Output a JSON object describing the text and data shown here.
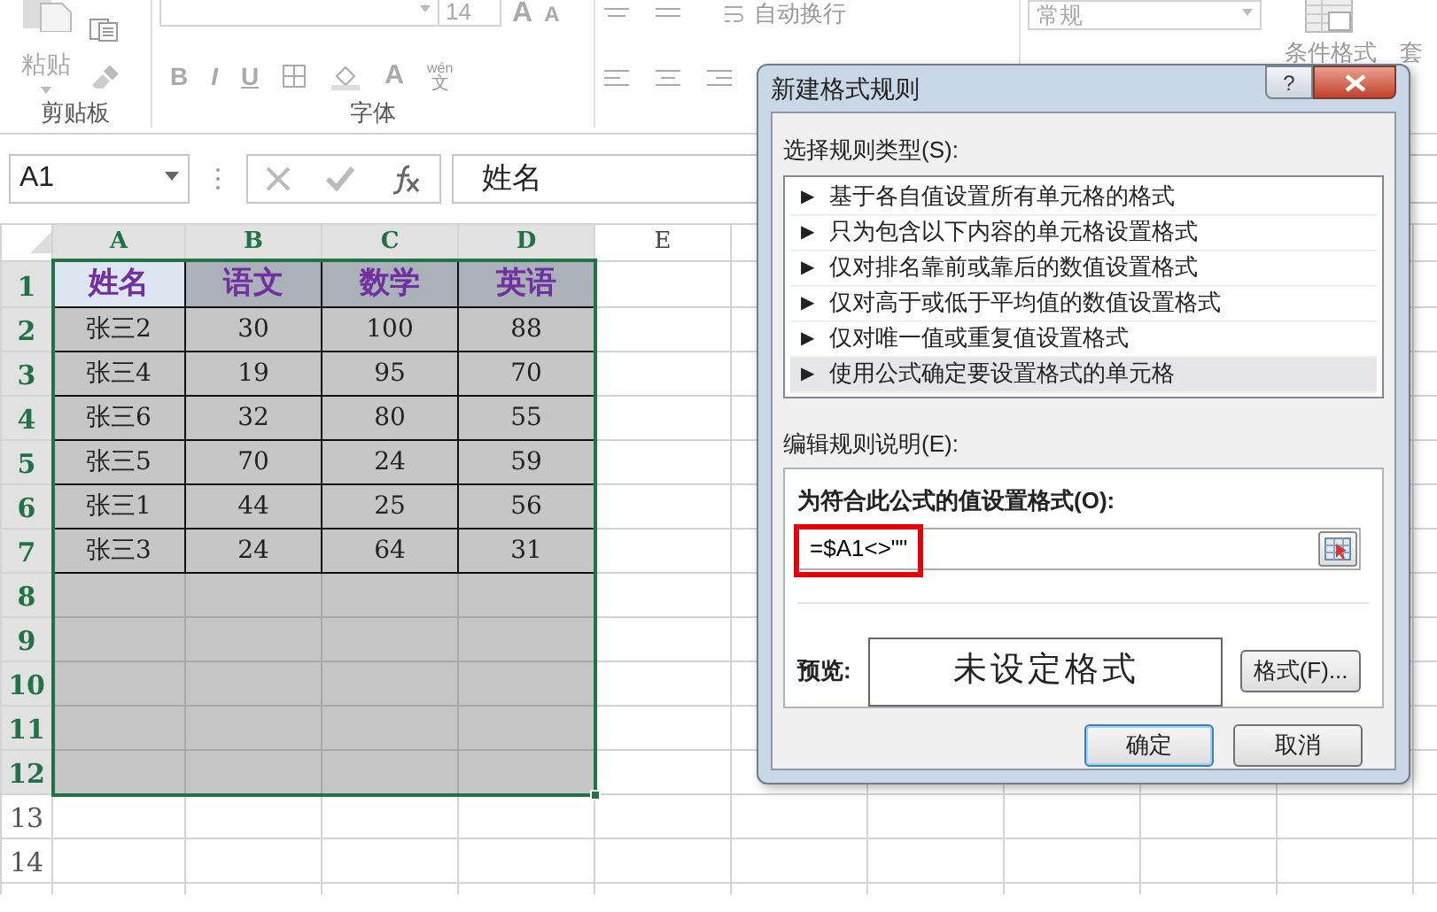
{
  "ribbon": {
    "clipboard": {
      "paste": "粘贴",
      "group_label": "剪贴板"
    },
    "font": {
      "size": "14",
      "grow": "A",
      "shrink": "A",
      "bold": "B",
      "italic": "I",
      "underline": "U",
      "font_color": "A",
      "phonetic_top": "wén",
      "phonetic_bottom": "文",
      "group_label": "字体"
    },
    "alignment": {
      "wrap_text": "自动换行"
    },
    "number": {
      "format": "常规"
    },
    "styles": {
      "conditional": "条件格式",
      "table_style": "套"
    }
  },
  "formula_bar": {
    "name_box": "A1",
    "formula": "姓名"
  },
  "sheet": {
    "columns": [
      {
        "label": "A",
        "selected": true
      },
      {
        "label": "B",
        "selected": true
      },
      {
        "label": "C",
        "selected": true
      },
      {
        "label": "D",
        "selected": true
      },
      {
        "label": "E",
        "selected": false
      }
    ],
    "rows": [
      {
        "number": "1",
        "selected": true,
        "cells": [
          "姓名",
          "语文",
          "数学",
          "英语"
        ]
      },
      {
        "number": "2",
        "selected": true,
        "cells": [
          "张三2",
          "30",
          "100",
          "88"
        ]
      },
      {
        "number": "3",
        "selected": true,
        "cells": [
          "张三4",
          "19",
          "95",
          "70"
        ]
      },
      {
        "number": "4",
        "selected": true,
        "cells": [
          "张三6",
          "32",
          "80",
          "55"
        ]
      },
      {
        "number": "5",
        "selected": true,
        "cells": [
          "张三5",
          "70",
          "24",
          "59"
        ]
      },
      {
        "number": "6",
        "selected": true,
        "cells": [
          "张三1",
          "44",
          "25",
          "56"
        ]
      },
      {
        "number": "7",
        "selected": true,
        "cells": [
          "张三3",
          "24",
          "64",
          "31"
        ]
      },
      {
        "number": "8",
        "selected": true,
        "cells": []
      },
      {
        "number": "9",
        "selected": true,
        "cells": []
      },
      {
        "number": "10",
        "selected": true,
        "cells": []
      },
      {
        "number": "11",
        "selected": true,
        "cells": []
      },
      {
        "number": "12",
        "selected": true,
        "cells": []
      },
      {
        "number": "13",
        "selected": false,
        "cells": []
      },
      {
        "number": "14",
        "selected": false,
        "cells": []
      }
    ]
  },
  "dialog": {
    "title": "新建格式规则",
    "help": "?",
    "rule_type_label": "选择规则类型(S):",
    "rule_types": [
      {
        "label": "基于各自值设置所有单元格的格式",
        "selected": false
      },
      {
        "label": "只为包含以下内容的单元格设置格式",
        "selected": false
      },
      {
        "label": "仅对排名靠前或靠后的数值设置格式",
        "selected": false
      },
      {
        "label": "仅对高于或低于平均值的数值设置格式",
        "selected": false
      },
      {
        "label": "仅对唯一值或重复值设置格式",
        "selected": false
      },
      {
        "label": "使用公式确定要设置格式的单元格",
        "selected": true
      }
    ],
    "bullet": "▶",
    "description_label": "编辑规则说明(E):",
    "formula_label": "为符合此公式的值设置格式(O):",
    "formula": {
      "value": "=$A1<>\"\"",
      "highlighted": true
    },
    "preview_label": "预览:",
    "preview_text": "未设定格式",
    "format_button": "格式(F)...",
    "buttons": [
      {
        "label": "确定",
        "default": true
      },
      {
        "label": "取消",
        "default": false
      }
    ]
  }
}
